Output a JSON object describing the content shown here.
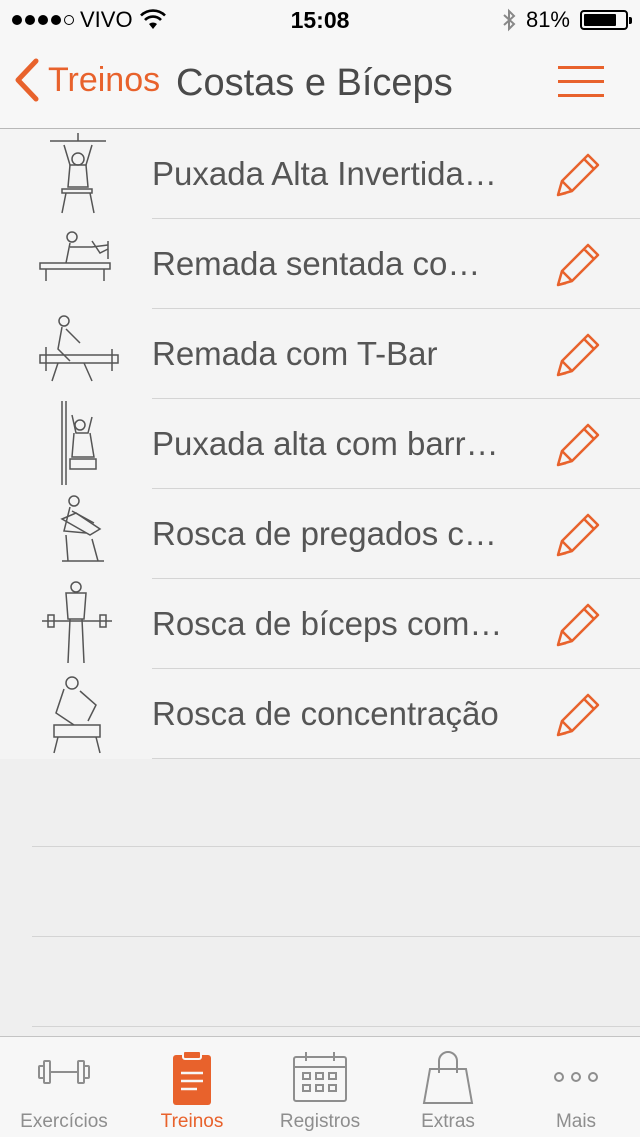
{
  "status": {
    "carrier": "VIVO",
    "time": "15:08",
    "battery": "81%",
    "battery_level": 0.81
  },
  "nav": {
    "back_label": "Treinos",
    "title": "Costas e Bíceps"
  },
  "exercises": [
    {
      "name": "Puxada Alta Invertida…"
    },
    {
      "name": "Remada sentada co…"
    },
    {
      "name": "Remada com T-Bar"
    },
    {
      "name": "Puxada alta com barr…"
    },
    {
      "name": "Rosca de pregados c…"
    },
    {
      "name": "Rosca de bíceps com…"
    },
    {
      "name": "Rosca de concentração"
    }
  ],
  "tabs": [
    {
      "label": "Exercícios",
      "icon": "dumbbell-icon"
    },
    {
      "label": "Treinos",
      "icon": "clipboard-icon",
      "active": true
    },
    {
      "label": "Registros",
      "icon": "calendar-icon"
    },
    {
      "label": "Extras",
      "icon": "shopping-bag-icon"
    },
    {
      "label": "Mais",
      "icon": "more-dots-icon"
    }
  ],
  "colors": {
    "accent": "#e8622c",
    "text": "#4a4a4a",
    "inactive": "#8e8e8e"
  }
}
